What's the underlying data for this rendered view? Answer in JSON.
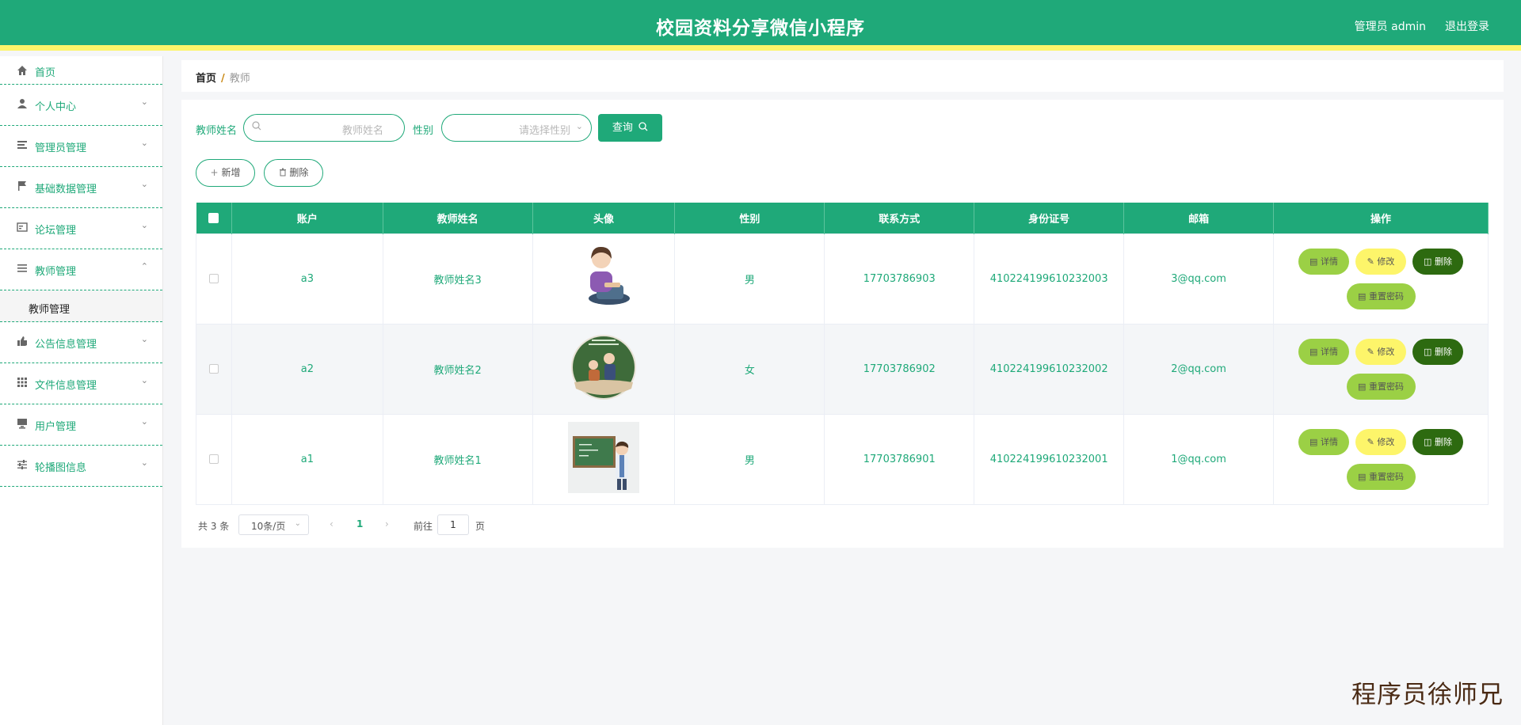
{
  "header": {
    "title": "校园资料分享微信小程序",
    "user": "管理员 admin",
    "logout": "退出登录"
  },
  "sidebar": {
    "items": [
      {
        "label": "首页",
        "icon": "home-icon"
      },
      {
        "label": "个人中心",
        "icon": "user-icon"
      },
      {
        "label": "管理员管理",
        "icon": "list-icon"
      },
      {
        "label": "基础数据管理",
        "icon": "flag-icon"
      },
      {
        "label": "论坛管理",
        "icon": "card-icon"
      },
      {
        "label": "教师管理",
        "icon": "menu-icon",
        "expanded": true,
        "sub": "教师管理"
      },
      {
        "label": "公告信息管理",
        "icon": "thumb-icon"
      },
      {
        "label": "文件信息管理",
        "icon": "grid-icon"
      },
      {
        "label": "用户管理",
        "icon": "monitor-icon"
      },
      {
        "label": "轮播图信息",
        "icon": "sliders-icon"
      }
    ]
  },
  "breadcrumb": {
    "home": "首页",
    "sep": "/",
    "current": "教师"
  },
  "search": {
    "name_label": "教师姓名",
    "name_placeholder": "教师姓名",
    "gender_label": "性别",
    "gender_placeholder": "请选择性别",
    "query_button": "查询"
  },
  "actions": {
    "add": "新增",
    "delete": "删除"
  },
  "table": {
    "columns": [
      "账户",
      "教师姓名",
      "头像",
      "性别",
      "联系方式",
      "身份证号",
      "邮箱",
      "操作"
    ],
    "rows": [
      {
        "account": "a3",
        "name": "教师姓名3",
        "gender": "男",
        "phone": "17703786903",
        "idcard": "410224199610232003",
        "email": "3@qq.com"
      },
      {
        "account": "a2",
        "name": "教师姓名2",
        "gender": "女",
        "phone": "17703786902",
        "idcard": "410224199610232002",
        "email": "2@qq.com"
      },
      {
        "account": "a1",
        "name": "教师姓名1",
        "gender": "男",
        "phone": "17703786901",
        "idcard": "410224199610232001",
        "email": "1@qq.com"
      }
    ],
    "ops": {
      "detail": "详情",
      "edit": "修改",
      "delete": "删除",
      "reset": "重置密码"
    }
  },
  "pagination": {
    "total": "共 3 条",
    "page_size": "10条/页",
    "current_page": "1",
    "goto_label": "前往",
    "goto_value": "1",
    "page_word": "页"
  },
  "watermark": "程序员徐师兄",
  "colors": {
    "primary": "#1fa979",
    "accent_yellow": "#fdf56a",
    "detail_green": "#9bd045",
    "delete_dark": "#2d6a10"
  }
}
